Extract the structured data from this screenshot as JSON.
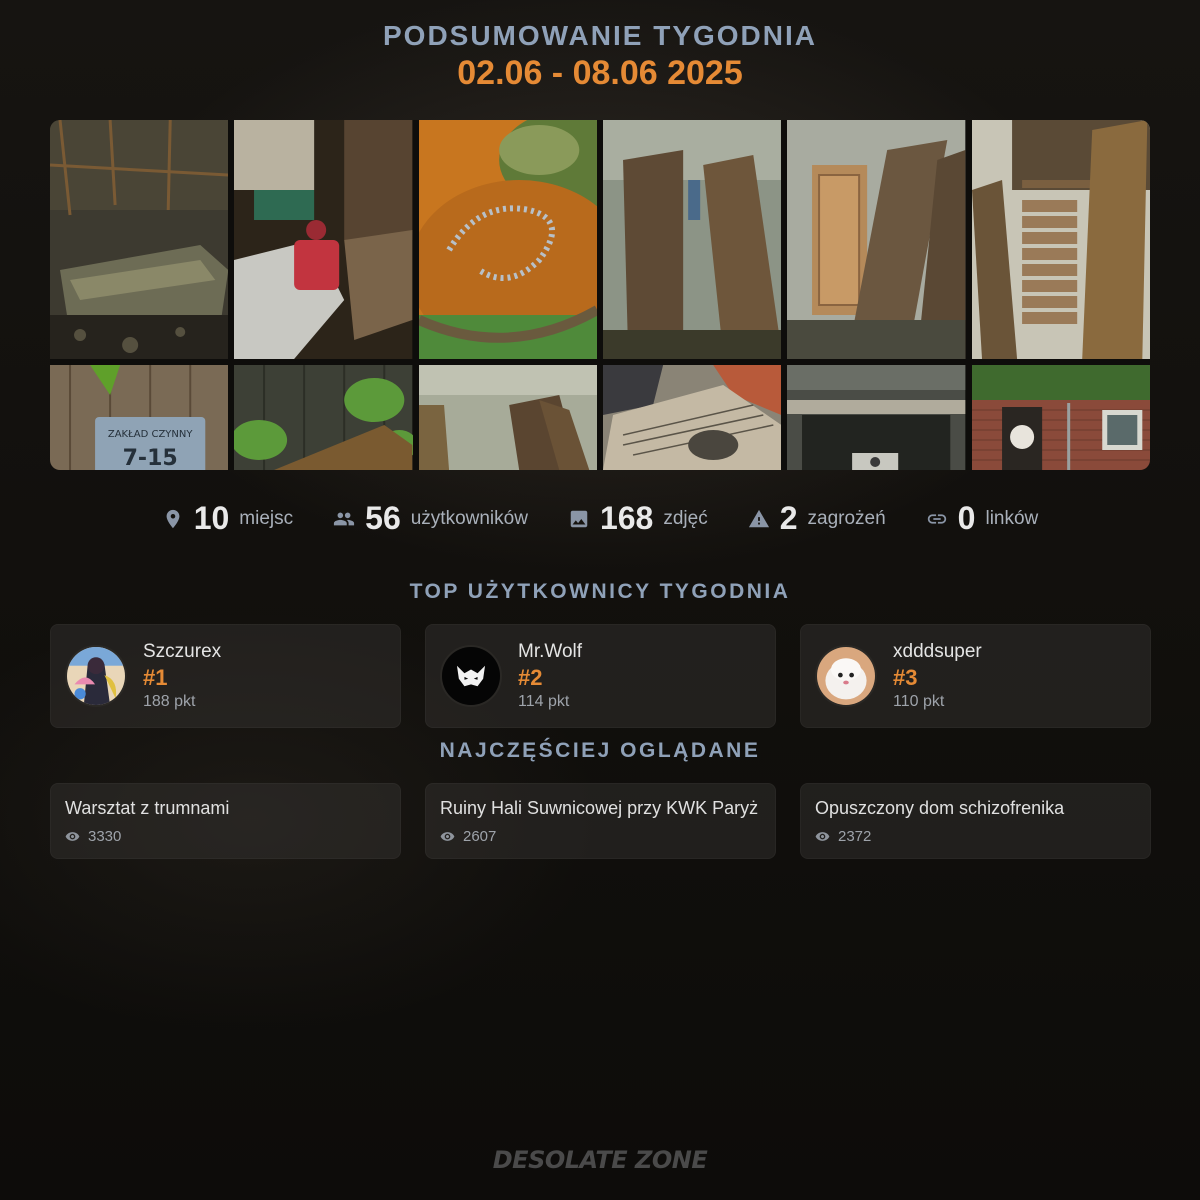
{
  "header": {
    "title": "PODSUMOWANIE TYGODNIA",
    "date_range": "02.06 - 08.06 2025"
  },
  "gallery": {
    "photos": [
      {
        "subject": "attic-coffin"
      },
      {
        "subject": "debris-machine"
      },
      {
        "subject": "rosary-rust"
      },
      {
        "subject": "coffins-leaning"
      },
      {
        "subject": "door-coffin"
      },
      {
        "subject": "workshop-planks"
      },
      {
        "subject": "wood-plate",
        "text": "ZAKŁAD CZYNNY",
        "text2": "7-15"
      },
      {
        "subject": "leaves-wood"
      },
      {
        "subject": "boards-room"
      },
      {
        "subject": "newspapers"
      },
      {
        "subject": "dark-window"
      },
      {
        "subject": "brick-house"
      }
    ]
  },
  "stats": [
    {
      "icon": "location-pin-icon",
      "value": "10",
      "label": "miejsc"
    },
    {
      "icon": "users-icon",
      "value": "56",
      "label": "użytkowników"
    },
    {
      "icon": "image-icon",
      "value": "168",
      "label": "zdjęć"
    },
    {
      "icon": "warning-icon",
      "value": "2",
      "label": "zagrożeń"
    },
    {
      "icon": "link-icon",
      "value": "0",
      "label": "linków"
    }
  ],
  "top_users": {
    "title": "TOP UŻYTKOWNICY TYGODNIA",
    "users": [
      {
        "name": "Szczurex",
        "rank": "#1",
        "points": "188 pkt"
      },
      {
        "name": "Mr.Wolf",
        "rank": "#2",
        "points": "114 pkt"
      },
      {
        "name": "xdddsuper",
        "rank": "#3",
        "points": "110 pkt"
      }
    ]
  },
  "most_viewed": {
    "title": "NAJCZĘŚCIEJ OGLĄDANE",
    "places": [
      {
        "name": "Warsztat z trumnami",
        "views": "3330"
      },
      {
        "name": "Ruiny Hali Suwnicowej przy KWK Paryż",
        "views": "2607"
      },
      {
        "name": "Opuszczony dom schizofrenika",
        "views": "2372"
      }
    ]
  },
  "footer": {
    "logo_text": "DESOLATE ZONE"
  },
  "colors": {
    "accent": "#e58a35",
    "heading": "#8fa1b8",
    "background": "#12100d"
  }
}
